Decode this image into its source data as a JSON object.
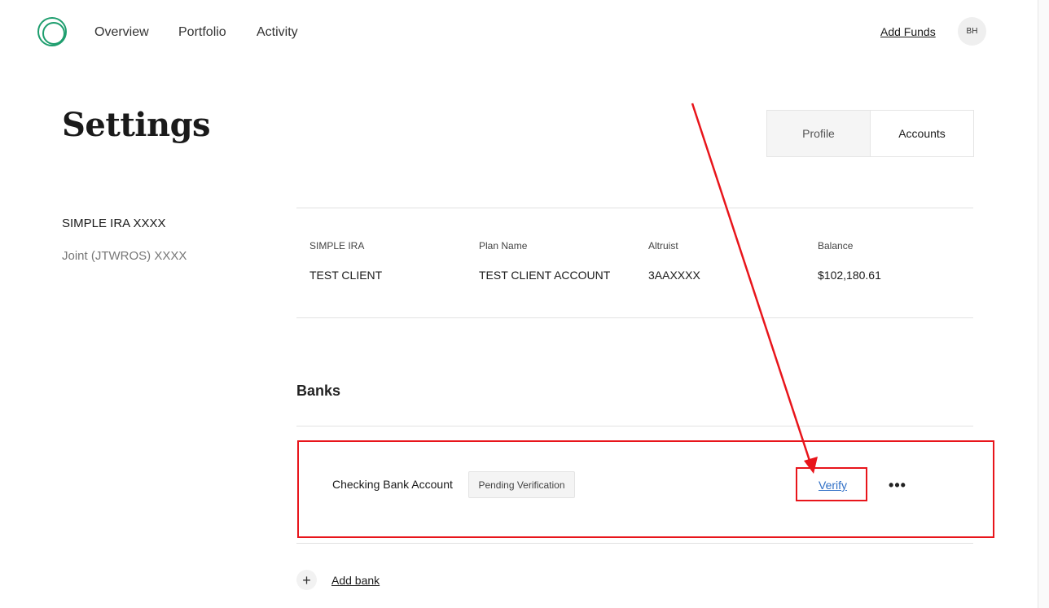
{
  "nav": {
    "logo_icon": "ring-logo-icon",
    "items": [
      "Overview",
      "Portfolio",
      "Activity"
    ],
    "add_funds": "Add Funds",
    "avatar_initials": "BH"
  },
  "page": {
    "title": "Settings"
  },
  "tabs": [
    {
      "label": "Profile",
      "active": false
    },
    {
      "label": "Accounts",
      "active": true
    }
  ],
  "accounts_sidebar": [
    {
      "label": "SIMPLE IRA XXXX",
      "selected": true
    },
    {
      "label": "Joint (JTWROS) XXXX",
      "selected": false
    }
  ],
  "account_details": {
    "columns": [
      {
        "label": "SIMPLE IRA",
        "value": "TEST CLIENT"
      },
      {
        "label": "Plan Name",
        "value": "TEST CLIENT ACCOUNT"
      },
      {
        "label": "Altruist",
        "value": "3AAXXXX"
      },
      {
        "label": "Balance",
        "value": "$102,180.61"
      }
    ]
  },
  "banks": {
    "title": "Banks",
    "items": [
      {
        "name": "Checking Bank Account",
        "status": "Pending Verification",
        "action": "Verify",
        "more_icon": "more-horizontal-icon"
      }
    ],
    "add_label": "Add bank",
    "add_icon": "plus-icon"
  },
  "colors": {
    "brand": "#1e9e6e",
    "link": "#2f6fc6",
    "annotation": "#e8151b"
  }
}
